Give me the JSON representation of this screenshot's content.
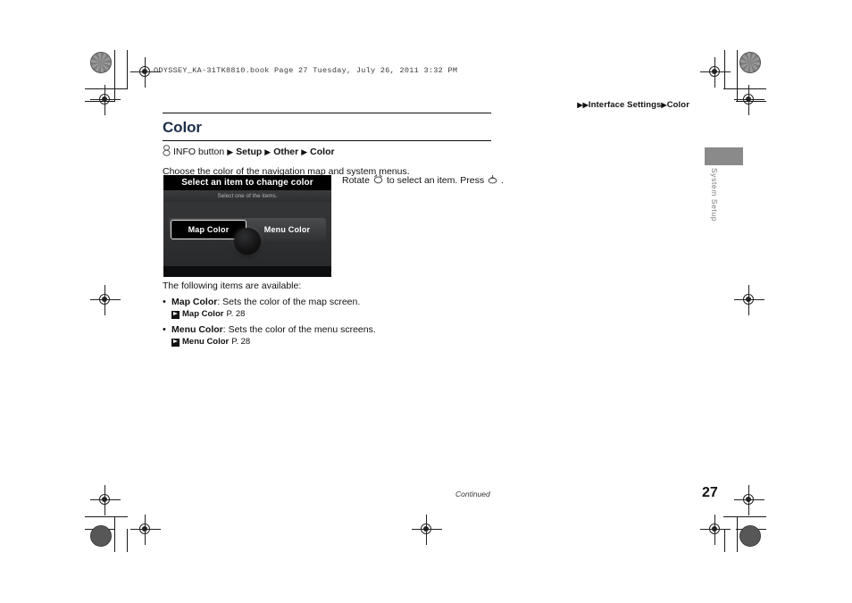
{
  "print_header": "ODYSSEY_KA-31TK8810.book  Page 27  Tuesday, July 26, 2011  3:32 PM",
  "breadcrumb": {
    "arrow1": "▶",
    "arrow2": "▶",
    "section": "Interface Settings",
    "arrow3": "▶",
    "page": "Color"
  },
  "page_title": "Color",
  "nav_path": {
    "knob_icon": "info-knob-icon",
    "start": "INFO button",
    "arrow": "▶",
    "step1": "Setup",
    "step2": "Other",
    "step3": "Color"
  },
  "intro": "Choose the color of the navigation map and system menus.",
  "screenshot": {
    "title": "Select an item to change color",
    "subtitle": "Select one of the items.",
    "buttons": [
      {
        "label": "Map Color",
        "selected": true
      },
      {
        "label": "Menu Color",
        "selected": false
      }
    ],
    "knob": "rotary-knob"
  },
  "caption_right": {
    "text_before": "Rotate",
    "rotate_icon": "rotate-knob-icon",
    "text_middle": "to select an item. Press",
    "press_icon": "press-knob-icon",
    "text_after": "."
  },
  "body": {
    "lead": "The following items are available:",
    "items": [
      {
        "bullet": "•",
        "name": "Map Color",
        "description": ": Sets the color of the map screen.",
        "ref_name": "Map Color",
        "ref_page": "P. 28"
      },
      {
        "bullet": "•",
        "name": "Menu Color",
        "description": ": Sets the color of the menu screens.",
        "ref_name": "Menu Color",
        "ref_page": "P. 28"
      }
    ]
  },
  "side_tab": "System Setup",
  "footer": {
    "continued": "Continued",
    "page_number": "27"
  },
  "colors": {
    "title_blue": "#1b2f4a",
    "tab_gray": "#8a8a8a",
    "screen_black": "#000000"
  }
}
